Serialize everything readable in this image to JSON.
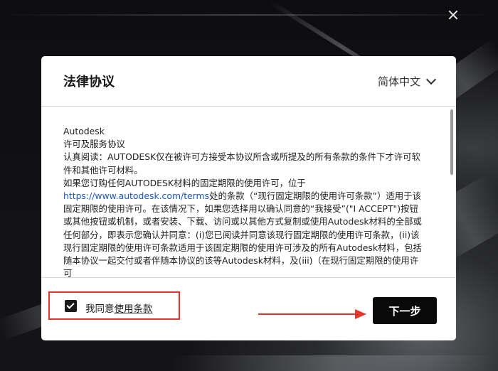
{
  "window": {
    "close_icon": "close-icon"
  },
  "dialog": {
    "title": "法律协议",
    "language_selected": "简体中文",
    "license_lines": [
      "Autodesk",
      "许可及服务协议",
      "认真阅读：AUTODESK仅在被许可方接受本协议所含或所提及的所有条款的条件下才许可软件和其他许可材料。",
      "如果您订购任何AUTODESK材料的固定期限的使用许可，位于"
    ],
    "license_link": "https://www.autodesk.com/terms",
    "license_tail": "处的条款（“现行固定期限的使用许可条款”）适用于该固定期限的使用许可。在该情况下，如果您选择用以确认同意的“我接受”(\"I ACCEPT\")按钮或其他按钮或机制，或者安装、下载、访问或以其他方式复制或使用Autodesk材料的全部或任何部分，即表示您确认并同意：(i)您已阅读并同意该现行固定期限的使用许可条款，(ii)该现行固定期限的使用许可条款适用于该固定期限的使用许可涉及的所有Autodesk材料，包括随本协议一起交付或者伴随本协议的该等Autodesk材料，及(iii)（在现行固定期限的使用许可",
    "agree_prefix": "我同意",
    "agree_link": "使用条款",
    "next_label": "下一步"
  },
  "colors": {
    "annotation": "#e5342a",
    "button": "#0a0a0a",
    "link": "#1a57c6"
  }
}
